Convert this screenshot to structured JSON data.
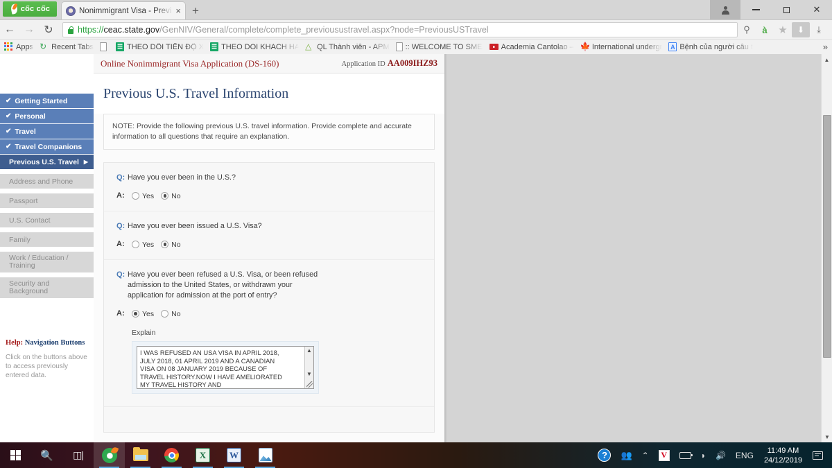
{
  "browser": {
    "brand": "cốc cốc",
    "tab": {
      "title": "Nonimmigrant Visa - Previ",
      "close": "×",
      "favicon_name": "seal-favicon"
    },
    "newtab_label": "+",
    "window_controls": {
      "profile": "profile",
      "minimize": "—",
      "maximize": "❐",
      "close": "✕"
    },
    "nav": {
      "back": "←",
      "forward": "→",
      "reload": "↻"
    },
    "url": {
      "scheme": "https://",
      "host": "ceac.state.gov",
      "path": "/GenNIV/General/complete/complete_previousustravel.aspx?node=PreviousUSTravel",
      "full": "https://ceac.state.gov/GenNIV/General/complete/complete_previousustravel.aspx?node=PreviousUSTravel",
      "secure": true
    },
    "url_icons": [
      {
        "name": "zoom-out-icon",
        "glyph": "⊖"
      },
      {
        "name": "translate-icon",
        "glyph": "à"
      },
      {
        "name": "bookmark-star-icon",
        "glyph": "★"
      },
      {
        "name": "download-arrow-icon",
        "glyph": "⬇"
      },
      {
        "name": "downloads-tray-icon",
        "glyph": "⤓"
      }
    ],
    "bookmarks": [
      {
        "label": "Apps",
        "icon": "apps-grid-icon"
      },
      {
        "label": "Recent Tabs",
        "icon": "history-clock-icon"
      },
      {
        "label": "",
        "icon": "document-icon"
      },
      {
        "label": "THEO DÕI TIẾN ĐỘ X",
        "icon": "google-sheets-icon"
      },
      {
        "label": "THEO DOI KHACH HA",
        "icon": "google-sheets-icon"
      },
      {
        "label": "QL Thành viên - APM",
        "icon": "apm-icon"
      },
      {
        "label": ":: WELCOME TO SMEA",
        "icon": "document-icon"
      },
      {
        "label": "Academia Cantolao –",
        "icon": "academia-icon"
      },
      {
        "label": "International undergr",
        "icon": "maple-leaf-icon"
      },
      {
        "label": "Bệnh của người câu t",
        "icon": "blue-a-icon"
      }
    ],
    "bookmarks_overflow": "»"
  },
  "app": {
    "header_title": "Online Nonimmigrant Visa Application (DS-160)",
    "application_id_label": "Application ID",
    "application_id": "AA009IHZ93",
    "page_title": "Previous U.S. Travel Information",
    "note": "NOTE: Provide the following previous U.S. travel information. Provide complete and accurate information to all questions that require an explanation."
  },
  "sidebar": {
    "items": [
      {
        "label": "Getting Started",
        "state": "done",
        "check": "✔"
      },
      {
        "label": "Personal",
        "state": "done",
        "check": "✔"
      },
      {
        "label": "Travel",
        "state": "done",
        "check": "✔"
      },
      {
        "label": "Travel Companions",
        "state": "done",
        "check": "✔"
      },
      {
        "label": "Previous U.S. Travel",
        "state": "current",
        "caret": "▶"
      },
      {
        "label": "Address and Phone",
        "state": "future"
      },
      {
        "label": "Passport",
        "state": "future"
      },
      {
        "label": "U.S. Contact",
        "state": "future"
      },
      {
        "label": "Family",
        "state": "future"
      },
      {
        "label": "Work / Education / Training",
        "state": "future"
      },
      {
        "label": "Security and Background",
        "state": "future"
      }
    ],
    "help": {
      "title_highlight": "Help:",
      "title_rest": " Navigation Buttons",
      "text": "Click on the buttons above to access previously entered data."
    }
  },
  "questions": [
    {
      "q_tag": "Q:",
      "a_tag": "A:",
      "text": "Have you ever been in the U.S.?",
      "options": [
        {
          "label": "Yes",
          "checked": false
        },
        {
          "label": "No",
          "checked": true
        }
      ]
    },
    {
      "q_tag": "Q:",
      "a_tag": "A:",
      "text": "Have you ever been issued a U.S. Visa?",
      "options": [
        {
          "label": "Yes",
          "checked": false
        },
        {
          "label": "No",
          "checked": true
        }
      ]
    },
    {
      "q_tag": "Q:",
      "a_tag": "A:",
      "text": "Have you ever been refused a U.S. Visa, or been refused admission to the United States, or withdrawn your application for admission at the port of entry?",
      "options": [
        {
          "label": "Yes",
          "checked": true
        },
        {
          "label": "No",
          "checked": false
        }
      ],
      "explain_label": "Explain",
      "explain_value": "I WAS REFUSED AN USA VISA IN APRIL 2018, JULY 2018, 01 APRIL 2019 AND A CANADIAN VISA ON 08 JANUARY 2019 BECAUSE OF TRAVEL HISTORY.NOW I HAVE AMELIORATED MY TRAVEL HISTORY AND"
    }
  ],
  "taskbar": {
    "items": [
      {
        "name": "start-button",
        "icon": "windows-logo-icon",
        "active": false,
        "running": false
      },
      {
        "name": "search-button",
        "icon": "search-icon",
        "active": false,
        "running": false
      },
      {
        "name": "task-view-button",
        "icon": "task-view-icon",
        "active": false,
        "running": false
      },
      {
        "name": "coccoc-browser",
        "icon": "coccoc-icon",
        "active": true,
        "running": true
      },
      {
        "name": "file-explorer",
        "icon": "folder-icon",
        "active": false,
        "running": true
      },
      {
        "name": "chrome-browser",
        "icon": "chrome-icon",
        "active": false,
        "running": true
      },
      {
        "name": "excel",
        "icon": "excel-icon",
        "label": "X",
        "active": false,
        "running": true
      },
      {
        "name": "word",
        "icon": "word-icon",
        "label": "W",
        "active": false,
        "running": true
      },
      {
        "name": "photos",
        "icon": "photos-icon",
        "active": false,
        "running": true
      }
    ],
    "tray": {
      "help_glyph": "?",
      "people_glyph": "⛹",
      "chevron_glyph": "⌃",
      "unikey_label": "V",
      "wifi_glyph": "◠",
      "volume_glyph": "🔊",
      "language": "ENG",
      "time": "11:49 AM",
      "date": "24/12/2019"
    }
  },
  "colors": {
    "sidebar_done": "#5a7fb8",
    "sidebar_current": "#3e5d8f",
    "sidebar_future": "#d7d7d7",
    "app_title": "#9c2b2b",
    "page_title": "#2b4570",
    "application_id": "#8b1a1a",
    "help_highlight": "#a31919",
    "q_tag": "#4a7ab5"
  }
}
